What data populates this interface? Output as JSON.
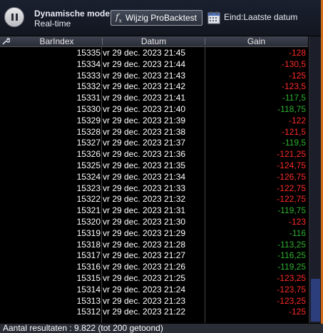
{
  "topbar": {
    "mode_title": "Dynamische mode",
    "mode_sub": "Real-time",
    "probacktest_label": "Wijzig ProBacktest",
    "end_label": "Eind:Laatste datum"
  },
  "table": {
    "columns": [
      "BarIndex",
      "Datum",
      "Gain"
    ],
    "rows": [
      {
        "index": "15335",
        "date": "vr 29 dec. 2023 21:45",
        "gain": "-128",
        "color": "#ff2a2a"
      },
      {
        "index": "15334",
        "date": "vr 29 dec. 2023 21:44",
        "gain": "-130,5",
        "color": "#ff2a2a"
      },
      {
        "index": "15333",
        "date": "vr 29 dec. 2023 21:43",
        "gain": "-125",
        "color": "#ff2a2a"
      },
      {
        "index": "15332",
        "date": "vr 29 dec. 2023 21:42",
        "gain": "-123,5",
        "color": "#ff2a2a"
      },
      {
        "index": "15331",
        "date": "vr 29 dec. 2023 21:41",
        "gain": "-117,5",
        "color": "#2fb02f"
      },
      {
        "index": "15330",
        "date": "vr 29 dec. 2023 21:40",
        "gain": "-118,75",
        "color": "#2fb02f"
      },
      {
        "index": "15329",
        "date": "vr 29 dec. 2023 21:39",
        "gain": "-122",
        "color": "#ff2a2a"
      },
      {
        "index": "15328",
        "date": "vr 29 dec. 2023 21:38",
        "gain": "-121,5",
        "color": "#ff2a2a"
      },
      {
        "index": "15327",
        "date": "vr 29 dec. 2023 21:37",
        "gain": "-119,5",
        "color": "#2fb02f"
      },
      {
        "index": "15326",
        "date": "vr 29 dec. 2023 21:36",
        "gain": "-121,25",
        "color": "#ff2a2a"
      },
      {
        "index": "15325",
        "date": "vr 29 dec. 2023 21:35",
        "gain": "-124,75",
        "color": "#ff2a2a"
      },
      {
        "index": "15324",
        "date": "vr 29 dec. 2023 21:34",
        "gain": "-126,75",
        "color": "#ff2a2a"
      },
      {
        "index": "15323",
        "date": "vr 29 dec. 2023 21:33",
        "gain": "-122,75",
        "color": "#ff2a2a"
      },
      {
        "index": "15322",
        "date": "vr 29 dec. 2023 21:32",
        "gain": "-122,75",
        "color": "#ff2a2a"
      },
      {
        "index": "15321",
        "date": "vr 29 dec. 2023 21:31",
        "gain": "-119,75",
        "color": "#2fb02f"
      },
      {
        "index": "15320",
        "date": "vr 29 dec. 2023 21:30",
        "gain": "-123",
        "color": "#ff2a2a"
      },
      {
        "index": "15319",
        "date": "vr 29 dec. 2023 21:29",
        "gain": "-116",
        "color": "#2fb02f"
      },
      {
        "index": "15318",
        "date": "vr 29 dec. 2023 21:28",
        "gain": "-113,25",
        "color": "#2fb02f"
      },
      {
        "index": "15317",
        "date": "vr 29 dec. 2023 21:27",
        "gain": "-116,25",
        "color": "#2fb02f"
      },
      {
        "index": "15316",
        "date": "vr 29 dec. 2023 21:26",
        "gain": "-119,25",
        "color": "#2fb02f"
      },
      {
        "index": "15315",
        "date": "vr 29 dec. 2023 21:25",
        "gain": "-123,25",
        "color": "#ff2a2a"
      },
      {
        "index": "15314",
        "date": "vr 29 dec. 2023 21:24",
        "gain": "-123,75",
        "color": "#ff2a2a"
      },
      {
        "index": "15313",
        "date": "vr 29 dec. 2023 21:23",
        "gain": "-123,25",
        "color": "#ff2a2a"
      },
      {
        "index": "15312",
        "date": "vr 29 dec. 2023 21:22",
        "gain": "-125",
        "color": "#ff2a2a"
      }
    ]
  },
  "status": {
    "text": "Aantal resultaten : 9.822 (tot 200 getoond)"
  },
  "icons": {
    "pause": "pause-icon",
    "fx": "fx-icon",
    "calendar": "calendar-icon",
    "wrench": "wrench-icon"
  }
}
